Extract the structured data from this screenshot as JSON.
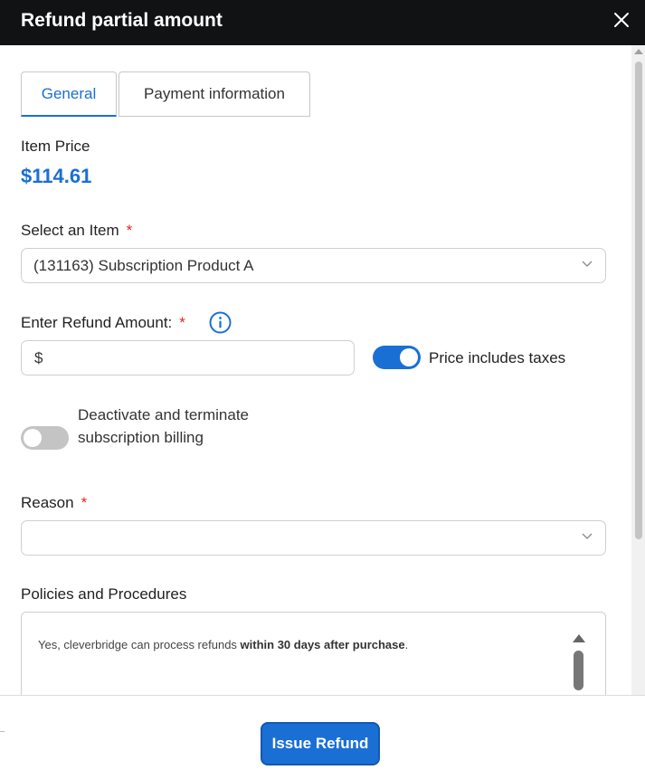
{
  "dialog": {
    "title": "Refund partial amount",
    "close_icon": "close-icon"
  },
  "tabs": [
    {
      "label": "General",
      "active": true
    },
    {
      "label": "Payment information",
      "active": false
    }
  ],
  "item_price": {
    "label": "Item Price",
    "value": "$114.61"
  },
  "select_item": {
    "label": "Select an Item",
    "required_mark": "*",
    "value": "(131163) Subscription Product A",
    "icon": "chevron-down-icon"
  },
  "refund_amount": {
    "label": "Enter Refund Amount:",
    "required_mark": "*",
    "info_icon": "info-icon",
    "prefix": "$",
    "value": ""
  },
  "price_includes_taxes": {
    "label": "Price includes taxes",
    "enabled": true
  },
  "deactivate_subscription": {
    "label": "Deactivate and terminate subscription billing",
    "enabled": false
  },
  "reason": {
    "label": "Reason",
    "required_mark": "*",
    "value": "",
    "icon": "chevron-down-icon"
  },
  "policies": {
    "label": "Policies and Procedures",
    "text_prefix": "Yes, cleverbridge can process refunds ",
    "text_bold": "within 30 days after purchase",
    "text_suffix": "."
  },
  "footer": {
    "issue_refund_label": "Issue Refund"
  },
  "colors": {
    "accent": "#1a6fd4",
    "title_bar": "#111214",
    "required": "#e0271b"
  }
}
